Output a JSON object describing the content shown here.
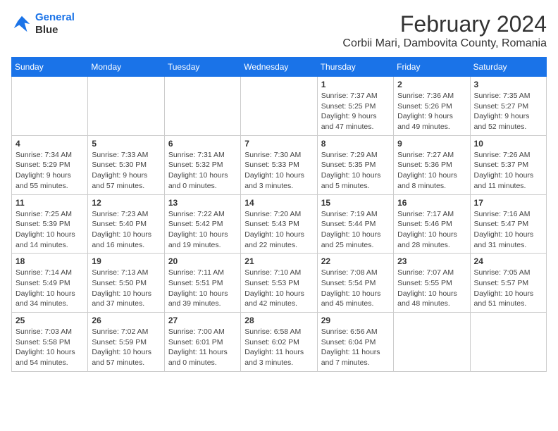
{
  "logo": {
    "line1": "General",
    "line2": "Blue"
  },
  "title": "February 2024",
  "subtitle": "Corbii Mari, Dambovita County, Romania",
  "days_of_week": [
    "Sunday",
    "Monday",
    "Tuesday",
    "Wednesday",
    "Thursday",
    "Friday",
    "Saturday"
  ],
  "weeks": [
    [
      {
        "day": "",
        "info": ""
      },
      {
        "day": "",
        "info": ""
      },
      {
        "day": "",
        "info": ""
      },
      {
        "day": "",
        "info": ""
      },
      {
        "day": "1",
        "info": "Sunrise: 7:37 AM\nSunset: 5:25 PM\nDaylight: 9 hours and 47 minutes."
      },
      {
        "day": "2",
        "info": "Sunrise: 7:36 AM\nSunset: 5:26 PM\nDaylight: 9 hours and 49 minutes."
      },
      {
        "day": "3",
        "info": "Sunrise: 7:35 AM\nSunset: 5:27 PM\nDaylight: 9 hours and 52 minutes."
      }
    ],
    [
      {
        "day": "4",
        "info": "Sunrise: 7:34 AM\nSunset: 5:29 PM\nDaylight: 9 hours and 55 minutes."
      },
      {
        "day": "5",
        "info": "Sunrise: 7:33 AM\nSunset: 5:30 PM\nDaylight: 9 hours and 57 minutes."
      },
      {
        "day": "6",
        "info": "Sunrise: 7:31 AM\nSunset: 5:32 PM\nDaylight: 10 hours and 0 minutes."
      },
      {
        "day": "7",
        "info": "Sunrise: 7:30 AM\nSunset: 5:33 PM\nDaylight: 10 hours and 3 minutes."
      },
      {
        "day": "8",
        "info": "Sunrise: 7:29 AM\nSunset: 5:35 PM\nDaylight: 10 hours and 5 minutes."
      },
      {
        "day": "9",
        "info": "Sunrise: 7:27 AM\nSunset: 5:36 PM\nDaylight: 10 hours and 8 minutes."
      },
      {
        "day": "10",
        "info": "Sunrise: 7:26 AM\nSunset: 5:37 PM\nDaylight: 10 hours and 11 minutes."
      }
    ],
    [
      {
        "day": "11",
        "info": "Sunrise: 7:25 AM\nSunset: 5:39 PM\nDaylight: 10 hours and 14 minutes."
      },
      {
        "day": "12",
        "info": "Sunrise: 7:23 AM\nSunset: 5:40 PM\nDaylight: 10 hours and 16 minutes."
      },
      {
        "day": "13",
        "info": "Sunrise: 7:22 AM\nSunset: 5:42 PM\nDaylight: 10 hours and 19 minutes."
      },
      {
        "day": "14",
        "info": "Sunrise: 7:20 AM\nSunset: 5:43 PM\nDaylight: 10 hours and 22 minutes."
      },
      {
        "day": "15",
        "info": "Sunrise: 7:19 AM\nSunset: 5:44 PM\nDaylight: 10 hours and 25 minutes."
      },
      {
        "day": "16",
        "info": "Sunrise: 7:17 AM\nSunset: 5:46 PM\nDaylight: 10 hours and 28 minutes."
      },
      {
        "day": "17",
        "info": "Sunrise: 7:16 AM\nSunset: 5:47 PM\nDaylight: 10 hours and 31 minutes."
      }
    ],
    [
      {
        "day": "18",
        "info": "Sunrise: 7:14 AM\nSunset: 5:49 PM\nDaylight: 10 hours and 34 minutes."
      },
      {
        "day": "19",
        "info": "Sunrise: 7:13 AM\nSunset: 5:50 PM\nDaylight: 10 hours and 37 minutes."
      },
      {
        "day": "20",
        "info": "Sunrise: 7:11 AM\nSunset: 5:51 PM\nDaylight: 10 hours and 39 minutes."
      },
      {
        "day": "21",
        "info": "Sunrise: 7:10 AM\nSunset: 5:53 PM\nDaylight: 10 hours and 42 minutes."
      },
      {
        "day": "22",
        "info": "Sunrise: 7:08 AM\nSunset: 5:54 PM\nDaylight: 10 hours and 45 minutes."
      },
      {
        "day": "23",
        "info": "Sunrise: 7:07 AM\nSunset: 5:55 PM\nDaylight: 10 hours and 48 minutes."
      },
      {
        "day": "24",
        "info": "Sunrise: 7:05 AM\nSunset: 5:57 PM\nDaylight: 10 hours and 51 minutes."
      }
    ],
    [
      {
        "day": "25",
        "info": "Sunrise: 7:03 AM\nSunset: 5:58 PM\nDaylight: 10 hours and 54 minutes."
      },
      {
        "day": "26",
        "info": "Sunrise: 7:02 AM\nSunset: 5:59 PM\nDaylight: 10 hours and 57 minutes."
      },
      {
        "day": "27",
        "info": "Sunrise: 7:00 AM\nSunset: 6:01 PM\nDaylight: 11 hours and 0 minutes."
      },
      {
        "day": "28",
        "info": "Sunrise: 6:58 AM\nSunset: 6:02 PM\nDaylight: 11 hours and 3 minutes."
      },
      {
        "day": "29",
        "info": "Sunrise: 6:56 AM\nSunset: 6:04 PM\nDaylight: 11 hours and 7 minutes."
      },
      {
        "day": "",
        "info": ""
      },
      {
        "day": "",
        "info": ""
      }
    ]
  ]
}
